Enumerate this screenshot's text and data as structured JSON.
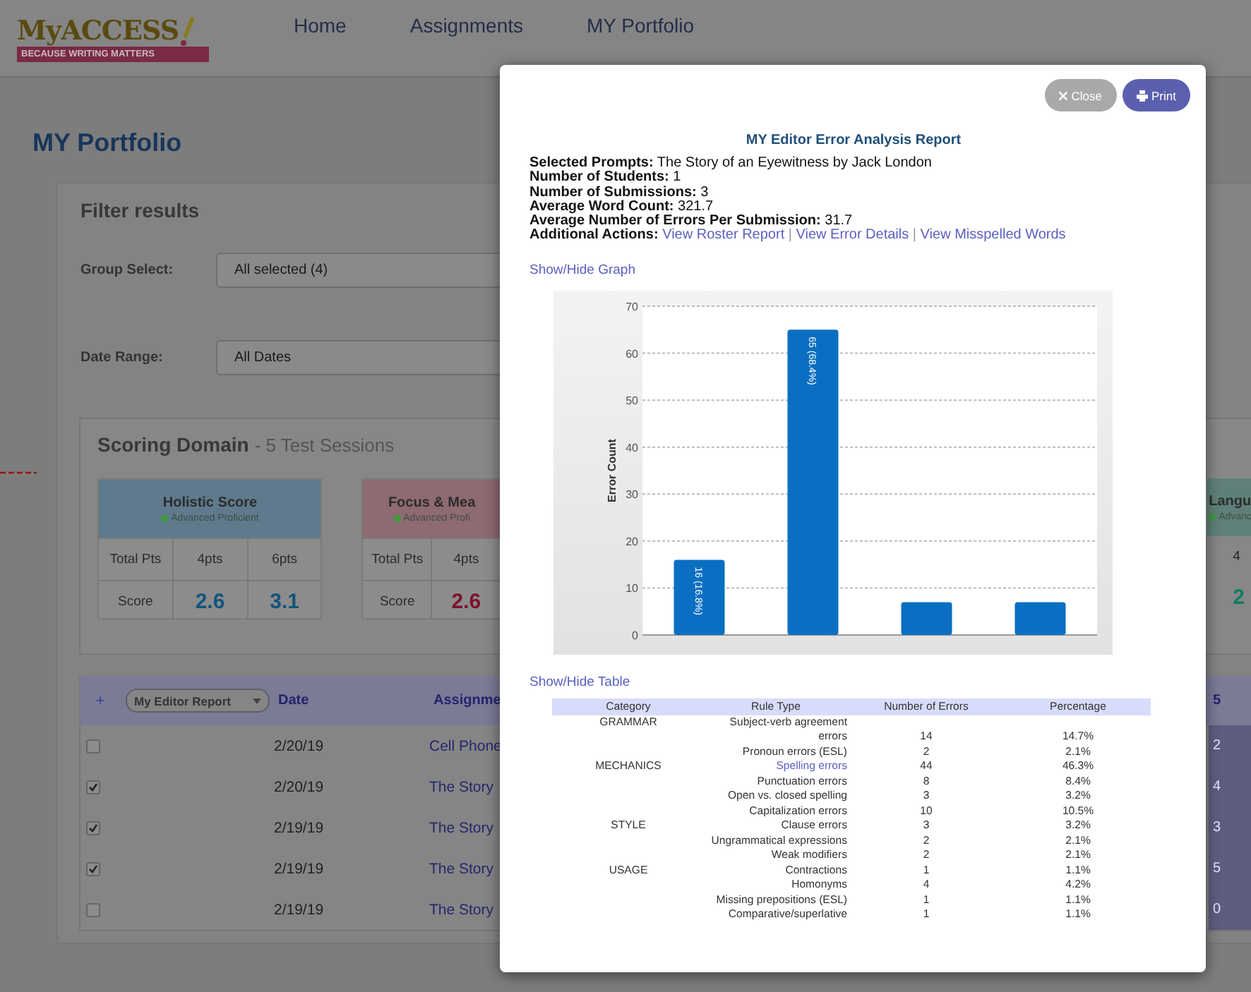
{
  "header": {
    "logo": {
      "wordmark": "MyACCESS",
      "tagline": "BECAUSE WRITING MATTERS"
    },
    "nav": [
      "Home",
      "Assignments",
      "MY Portfolio"
    ]
  },
  "page_title": "MY Portfolio",
  "filters": {
    "title": "Filter results",
    "fields": [
      {
        "label": "Group Select:",
        "value": "All selected (4)"
      },
      {
        "label": "Date Range:",
        "value": "All Dates"
      }
    ]
  },
  "scoring": {
    "title": "Scoring Domain",
    "subtitle": "- 5 Test Sessions",
    "cards": [
      {
        "title": "Holistic Score",
        "status": "Advanced Proficient",
        "color": "#5e7a8c",
        "columns": [
          "Total Pts",
          "4pts",
          "6pts"
        ],
        "scores": [
          "Score",
          "2.6",
          "3.1"
        ]
      },
      {
        "title": "Focus & Mea",
        "status": "Advanced Profi",
        "color": "#8e6a72",
        "columns": [
          "Total Pts",
          "4pts"
        ],
        "scores": [
          "Score",
          "2.6"
        ]
      }
    ],
    "edge_card": {
      "title": "Langu",
      "status": "Advanc",
      "color": "#5f8078",
      "column": "4",
      "score": "2"
    }
  },
  "portfolio_table": {
    "add": "+",
    "report_select": "My Editor Report",
    "columns": [
      "Date",
      "Assignme",
      "5"
    ],
    "rows": [
      {
        "checked": false,
        "date": "2/20/19",
        "assignment": "Cell Phone",
        "column_3": "2"
      },
      {
        "checked": true,
        "date": "2/20/19",
        "assignment": "The Story",
        "column_3": "4"
      },
      {
        "checked": true,
        "date": "2/19/19",
        "assignment": "The Story",
        "column_3": "3"
      },
      {
        "checked": true,
        "date": "2/19/19",
        "assignment": "The Story",
        "column_3": "5"
      },
      {
        "checked": false,
        "date": "2/19/19",
        "assignment": "The Story",
        "column_3": "0"
      }
    ]
  },
  "dialog": {
    "buttons": [
      {
        "label": "Close",
        "kind": "close"
      },
      {
        "label": "Print",
        "kind": "print"
      }
    ],
    "title": "MY Editor Error Analysis Report",
    "summary": [
      {
        "label": "Selected Prompts:",
        "value": "The Story of an Eyewitness by Jack London"
      },
      {
        "label": "Number of Students:",
        "value": "1"
      },
      {
        "label": "Number of Submissions:",
        "value": "3"
      },
      {
        "label": "Average Word Count:",
        "value": "321.7"
      },
      {
        "label": "Average Number of Errors Per Submission:",
        "value": "31.7"
      }
    ],
    "actions": {
      "label": "Additional Actions:",
      "separator": "|",
      "links": [
        "View Roster Report",
        "View Error Details",
        "View Misspelled Words"
      ]
    },
    "graph_toggle": "Show/Hide Graph",
    "chart_data": {
      "type": "bar",
      "grid": true,
      "ylabel": "Error Count",
      "values": [
        16,
        65,
        7,
        7
      ],
      "ylim": [
        0,
        70
      ],
      "yticks": [
        0,
        10,
        20,
        30,
        40,
        50,
        60,
        70
      ],
      "value_labels": [
        "16 (16.8%)",
        "65 (68.4%)",
        null,
        null
      ]
    },
    "table_toggle": "Show/Hide Table",
    "table": {
      "columns": [
        "Category",
        "Rule Type",
        "Number of Errors",
        "Percentage"
      ],
      "rows": [
        {
          "category": "GRAMMAR",
          "rule": "Subject-verb agreement errors",
          "linked": false,
          "count": "14",
          "percentage": "14.7%"
        },
        {
          "rule": "Pronoun errors (ESL)",
          "linked": false,
          "count": "2",
          "percentage": "2.1%"
        },
        {
          "category": "MECHANICS",
          "rule": "Spelling errors",
          "linked": true,
          "count": "44",
          "percentage": "46.3%"
        },
        {
          "rule": "Punctuation errors",
          "linked": false,
          "count": "8",
          "percentage": "8.4%"
        },
        {
          "rule": "Open vs. closed spelling",
          "linked": false,
          "count": "3",
          "percentage": "3.2%"
        },
        {
          "rule": "Capitalization errors",
          "linked": false,
          "count": "10",
          "percentage": "10.5%"
        },
        {
          "category": "STYLE",
          "rule": "Clause errors",
          "linked": false,
          "count": "3",
          "percentage": "3.2%"
        },
        {
          "rule": "Ungrammatical expressions",
          "linked": false,
          "count": "2",
          "percentage": "2.1%"
        },
        {
          "rule": "Weak modifiers",
          "linked": false,
          "count": "2",
          "percentage": "2.1%"
        },
        {
          "category": "USAGE",
          "rule": "Contractions",
          "linked": false,
          "count": "1",
          "percentage": "1.1%"
        },
        {
          "rule": "Homonyms",
          "linked": false,
          "count": "4",
          "percentage": "4.2%"
        },
        {
          "rule": "Missing prepositions (ESL)",
          "linked": false,
          "count": "1",
          "percentage": "1.1%"
        },
        {
          "rule": "Comparative/superlative",
          "linked": false,
          "count": "1",
          "percentage": "1.1%"
        }
      ]
    }
  }
}
